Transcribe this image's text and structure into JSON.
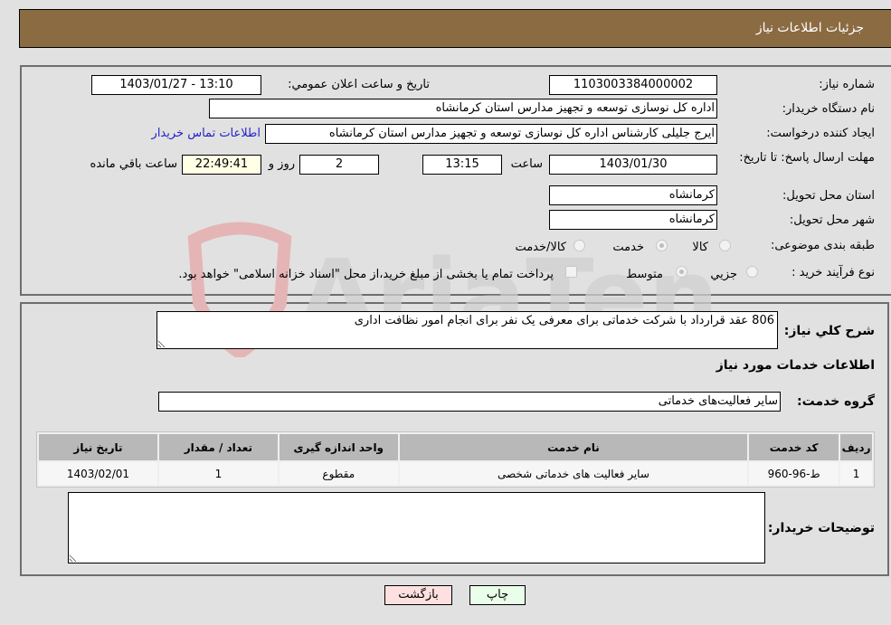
{
  "header": {
    "title": "جزئیات اطلاعات نیاز"
  },
  "form": {
    "need_number": {
      "label": "شماره نیاز:",
      "value": "1103003384000002"
    },
    "announce_datetime": {
      "label": "تاریخ و ساعت اعلان عمومي:",
      "value": "1403/01/27 - 13:10"
    },
    "buyer_org": {
      "label": "نام دستگاه خریدار:",
      "value": "اداره کل نوسازی  توسعه و تجهیز مدارس استان کرمانشاه"
    },
    "requester": {
      "label": "ایجاد کننده درخواست:",
      "value": "ایرج جلیلی کارشناس اداره کل نوسازی  توسعه و تجهیز مدارس استان کرمانشاه",
      "contact_link": "اطلاعات تماس خریدار"
    },
    "deadline": {
      "label": "مهلت ارسال پاسخ: تا تاریخ:",
      "date": "1403/01/30",
      "time_label": "ساعت",
      "time": "13:15",
      "days": "2",
      "days_label": "روز و",
      "remaining": "22:49:41",
      "remaining_label": "ساعت باقي مانده"
    },
    "province": {
      "label": "استان محل تحویل:",
      "value": "کرمانشاه"
    },
    "city": {
      "label": "شهر محل تحویل:",
      "value": "کرمانشاه"
    },
    "category": {
      "label": "طبقه بندی موضوعی:",
      "options": [
        "کالا",
        "خدمت",
        "کالا/خدمت"
      ],
      "selected": "خدمت"
    },
    "purchase_type": {
      "label": "نوع فرآیند خرید :",
      "options": [
        "جزيي",
        "متوسط"
      ],
      "selected": "متوسط",
      "treasury_note": "پرداخت تمام یا بخشی از مبلغ خرید،از محل \"اسناد خزانه اسلامی\" خواهد بود."
    }
  },
  "details": {
    "description_label": "شرح کلي نياز:",
    "description": "806 عقد قرارداد با شرکت خدماتی برای معرفی یک نفر برای انجام امور نظافت اداری",
    "services_title": "اطلاعات خدمات مورد نياز",
    "service_group_label": "گروه خدمت:",
    "service_group": "سایر فعالیت‌های خدماتی",
    "table": {
      "headers": [
        "ردیف",
        "کد خدمت",
        "نام خدمت",
        "واحد اندازه گیری",
        "تعداد / مقدار",
        "تاریخ نیاز"
      ],
      "rows": [
        [
          "1",
          "ط-96-960",
          "سایر فعالیت های خدماتی شخصی",
          "مقطوع",
          "1",
          "1403/02/01"
        ]
      ]
    },
    "buyer_notes_label": "توضیحات خریدار:",
    "buyer_notes": ""
  },
  "buttons": {
    "print": "چاپ",
    "back": "بازگشت"
  },
  "watermark": "AriaTender.neT"
}
